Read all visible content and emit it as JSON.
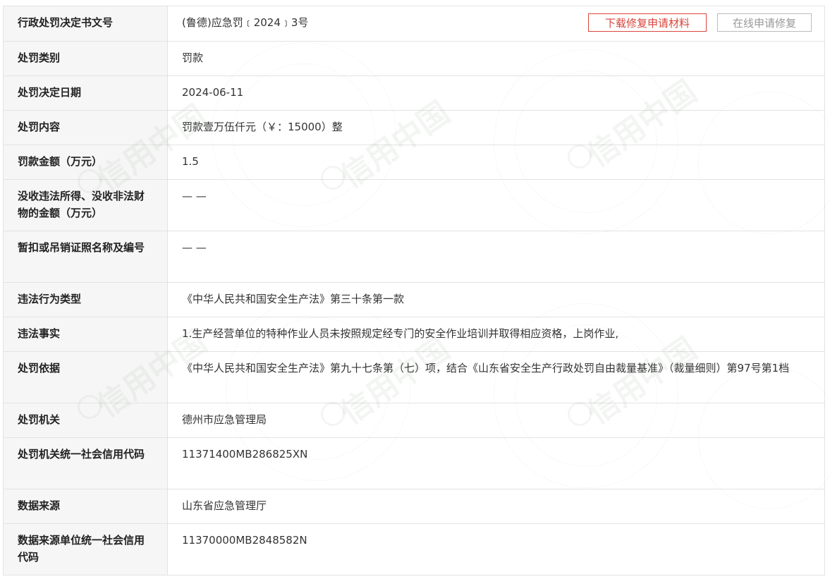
{
  "buttons": {
    "download": "下载修复申请材料",
    "online": "在线申请修复"
  },
  "rows": [
    {
      "label": "行政处罚决定书文号",
      "value": "(鲁德)应急罚﹝2024﹞3号"
    },
    {
      "label": "处罚类别",
      "value": "罚款"
    },
    {
      "label": "处罚决定日期",
      "value": "2024-06-11"
    },
    {
      "label": "处罚内容",
      "value": "罚款壹万伍仟元（￥：15000）整"
    },
    {
      "label": "罚款金额（万元）",
      "value": "1.5"
    },
    {
      "label": "没收违法所得、没收非法财物的金额（万元）",
      "value": "— —"
    },
    {
      "label": "暂扣或吊销证照名称及编号",
      "value": "— —"
    },
    {
      "label": "违法行为类型",
      "value": "《中华人民共和国安全生产法》第三十条第一款"
    },
    {
      "label": "违法事实",
      "value": "1.生产经营单位的特种作业人员未按照规定经专门的安全作业培训并取得相应资格，上岗作业,"
    },
    {
      "label": "处罚依据",
      "value": "《中华人民共和国安全生产法》第九十七条第（七）项，结合《山东省安全生产行政处罚自由裁量基准》（裁量细则）第97号第1档"
    },
    {
      "label": "处罚机关",
      "value": "德州市应急管理局"
    },
    {
      "label": "处罚机关统一社会信用代码",
      "value": "11371400MB286825XN"
    },
    {
      "label": "数据来源",
      "value": "山东省应急管理厅"
    },
    {
      "label": "数据来源单位统一社会信用代码",
      "value": "11370000MB2848582N"
    }
  ],
  "watermark": {
    "text": "信用中国"
  },
  "colors": {
    "accent": "#d9453c",
    "label_bg": "#f6f6f6",
    "border": "#e3e3e3"
  }
}
